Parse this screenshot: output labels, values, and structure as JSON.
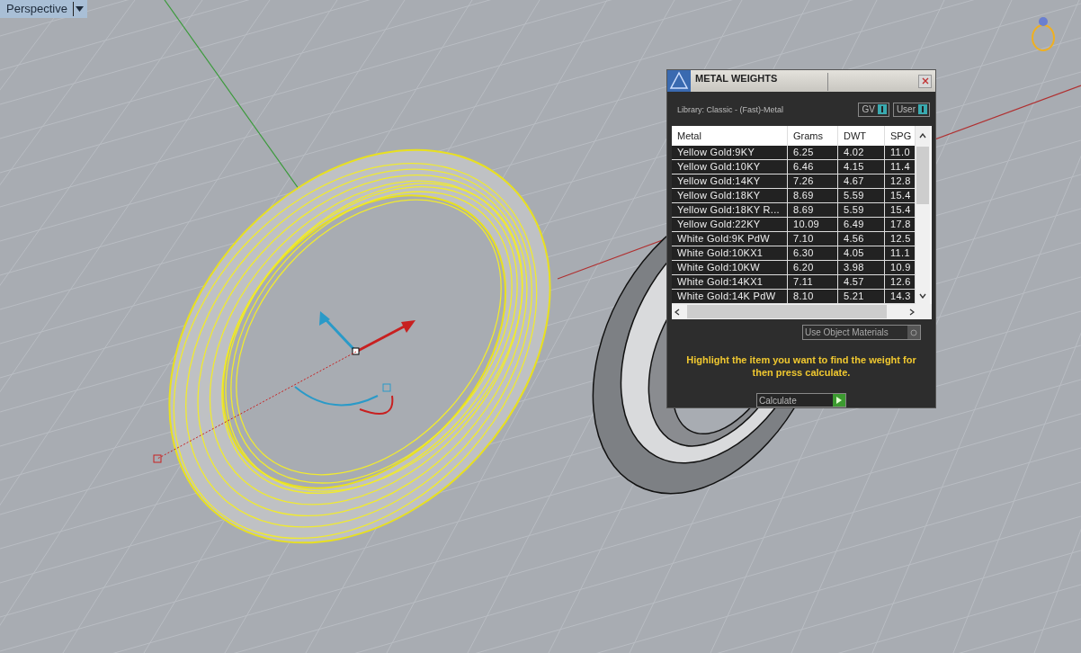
{
  "viewport": {
    "label": "Perspective"
  },
  "dialog": {
    "title": "METAL WEIGHTS",
    "library": "Library: Classic - (Fast)-Metal",
    "toggles": [
      {
        "label": "GV",
        "on": true
      },
      {
        "label": "User",
        "on": true
      }
    ],
    "table": {
      "columns": [
        "Metal",
        "Grams",
        "DWT",
        "SPG"
      ],
      "rows": [
        [
          "Yellow Gold:9KY",
          "6.25",
          "4.02",
          "11.0"
        ],
        [
          "Yellow Gold:10KY",
          "6.46",
          "4.15",
          "11.4"
        ],
        [
          "Yellow Gold:14KY",
          "7.26",
          "4.67",
          "12.8"
        ],
        [
          "Yellow Gold:18KY",
          "8.69",
          "5.59",
          "15.4"
        ],
        [
          "Yellow Gold:18KY R...",
          "8.69",
          "5.59",
          "15.4"
        ],
        [
          "Yellow Gold:22KY",
          "10.09",
          "6.49",
          "17.8"
        ],
        [
          "White Gold:9K PdW",
          "7.10",
          "4.56",
          "12.5"
        ],
        [
          "White Gold:10KX1",
          "6.30",
          "4.05",
          "11.1"
        ],
        [
          "White Gold:10KW",
          "6.20",
          "3.98",
          "10.9"
        ],
        [
          "White Gold:14KX1",
          "7.11",
          "4.57",
          "12.6"
        ],
        [
          "White Gold:14K PdW",
          "8.10",
          "5.21",
          "14.3"
        ]
      ]
    },
    "option": {
      "label": "Use Object Materials",
      "on": false
    },
    "message": "Highlight the item you want to find the weight for then press calculate.",
    "button": "Calculate"
  }
}
